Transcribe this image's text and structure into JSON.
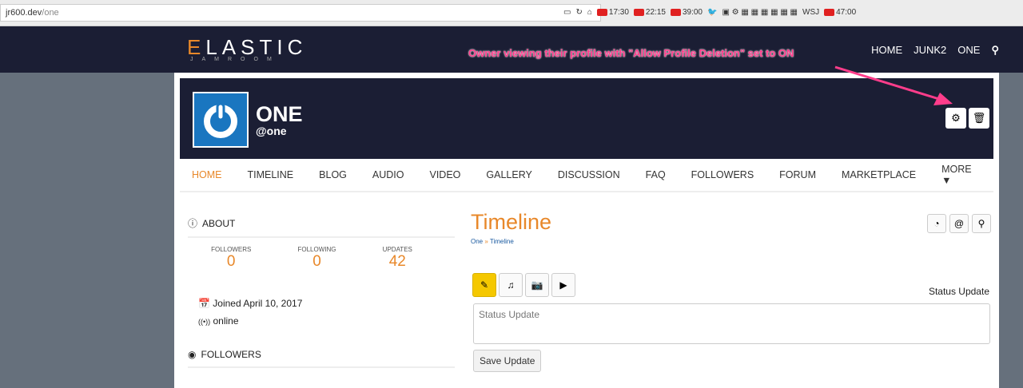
{
  "browser": {
    "url_host": "jr600.dev",
    "url_path": "/one",
    "bookmarks": [
      "17:30",
      "22:15",
      "39:00",
      "47:00"
    ],
    "wsj": "WSJ"
  },
  "site": {
    "logo_main": "LASTIC",
    "logo_e": "E",
    "logo_sub": "JAMROOM",
    "nav": [
      "HOME",
      "JUNK2",
      "ONE"
    ]
  },
  "annotation": "Owner viewing their profile with \"Allow Profile Deletion\" set to ON",
  "profile": {
    "name": "ONE",
    "handle": "@one"
  },
  "tabs": [
    "HOME",
    "TIMELINE",
    "BLOG",
    "AUDIO",
    "VIDEO",
    "GALLERY",
    "DISCUSSION",
    "FAQ",
    "FOLLOWERS",
    "FORUM",
    "MARKETPLACE",
    "MORE ▼"
  ],
  "about": {
    "title": "ABOUT",
    "stats": [
      {
        "label": "FOLLOWERS",
        "value": "0"
      },
      {
        "label": "FOLLOWING",
        "value": "0"
      },
      {
        "label": "UPDATES",
        "value": "42"
      }
    ],
    "joined": "Joined April 10, 2017",
    "status": "online"
  },
  "followers_title": "FOLLOWERS",
  "timeline": {
    "title": "Timeline",
    "crumb_1": "One",
    "crumb_sep": " » ",
    "crumb_2": "Timeline",
    "mode_label": "Status Update",
    "placeholder": "Status Update",
    "save": "Save Update"
  }
}
